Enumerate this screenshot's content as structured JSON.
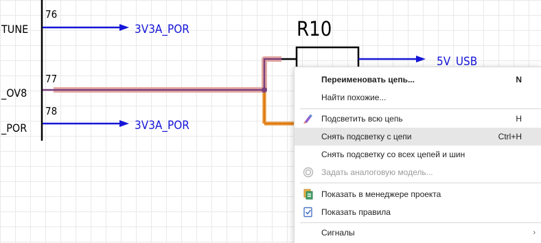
{
  "schematic": {
    "pins": [
      {
        "number": "76",
        "name": "TUNE"
      },
      {
        "number": "77",
        "name": "_OV8"
      },
      {
        "number": "78",
        "name": "_POR"
      }
    ],
    "net_labels": {
      "net_76": "3V3A_POR",
      "net_78": "3V3A_POR",
      "net_r10": "5V_USB"
    },
    "component": {
      "designator": "R10"
    },
    "colors": {
      "pin_wire": "#1515d8",
      "highlight_net": "#7b3f7b",
      "highlight_glow": "#e3a9a3",
      "orange_net": "#e07b10",
      "body": "#000000"
    }
  },
  "context_menu": {
    "items": [
      {
        "label": "Переименовать цепь...",
        "shortcut": "N",
        "bold": true,
        "icon": ""
      },
      {
        "label": "Найти похожие...",
        "shortcut": "",
        "icon": ""
      },
      {
        "label": "Подсветить всю цепь",
        "shortcut": "H",
        "icon": "highlighter-icon"
      },
      {
        "label": "Снять подсветку с цепи",
        "shortcut": "Ctrl+H",
        "icon": "",
        "highlighted": true
      },
      {
        "label": "Снять подсветку со всех цепей и шин",
        "shortcut": "",
        "icon": ""
      },
      {
        "label": "Задать аналоговую модель...",
        "shortcut": "",
        "icon": "analog-model-icon",
        "disabled": true
      },
      {
        "label": "Показать в менеджере проекта",
        "shortcut": "",
        "icon": "project-manager-icon"
      },
      {
        "label": "Показать правила",
        "shortcut": "",
        "icon": "rules-icon"
      },
      {
        "label": "Сигналы",
        "shortcut": "",
        "icon": "",
        "submenu": true
      }
    ]
  }
}
